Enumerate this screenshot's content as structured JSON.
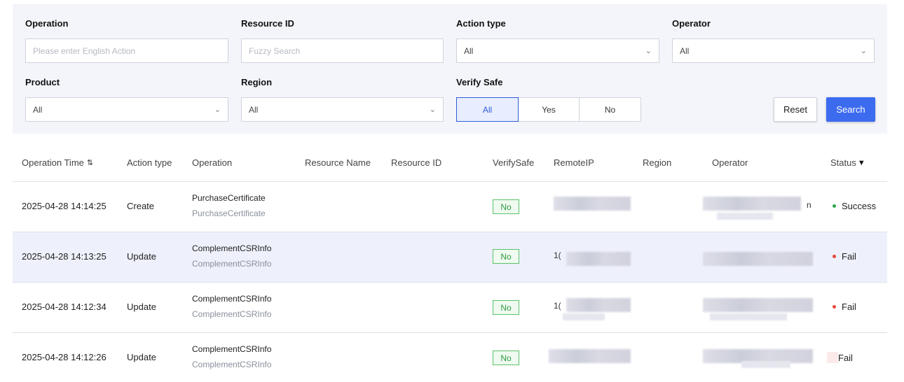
{
  "filters": {
    "operation": {
      "label": "Operation",
      "placeholder": "Please enter English Action"
    },
    "resource_id": {
      "label": "Resource ID",
      "placeholder": "Fuzzy Search"
    },
    "action_type": {
      "label": "Action type",
      "value": "All"
    },
    "operator": {
      "label": "Operator",
      "value": "All"
    },
    "product": {
      "label": "Product",
      "value": "All"
    },
    "region": {
      "label": "Region",
      "value": "All"
    },
    "verify_safe": {
      "label": "Verify Safe",
      "options": [
        "All",
        "Yes",
        "No"
      ],
      "selected": "All"
    },
    "reset_label": "Reset",
    "search_label": "Search"
  },
  "table": {
    "headers": {
      "time": "Operation Time",
      "action": "Action type",
      "operation": "Operation",
      "resource_name": "Resource Name",
      "resource_id": "Resource ID",
      "verify": "VerifySafe",
      "ip": "RemoteIP",
      "region": "Region",
      "operator": "Operator",
      "status": "Status"
    },
    "rows": [
      {
        "time": "2025-04-28 14:14:25",
        "action": "Create",
        "op_main": "PurchaseCertificate",
        "op_sub": "PurchaseCertificate",
        "verify": "No",
        "ip_frag": "",
        "op_frag": "n",
        "status": "Success"
      },
      {
        "time": "2025-04-28 14:13:25",
        "action": "Update",
        "op_main": "ComplementCSRInfo",
        "op_sub": "ComplementCSRInfo",
        "verify": "No",
        "ip_frag": "1(",
        "op_frag": "",
        "status": "Fail"
      },
      {
        "time": "2025-04-28 14:12:34",
        "action": "Update",
        "op_main": "ComplementCSRInfo",
        "op_sub": "ComplementCSRInfo",
        "verify": "No",
        "ip_frag": "1(",
        "op_frag": "",
        "status": "Fail"
      },
      {
        "time": "2025-04-28 14:12:26",
        "action": "Update",
        "op_main": "ComplementCSRInfo",
        "op_sub": "ComplementCSRInfo",
        "verify": "No",
        "ip_frag": "",
        "op_frag": "",
        "status": "Fail"
      }
    ]
  },
  "colors": {
    "success": "#2fa84f",
    "fail": "#e5483b",
    "primary": "#3d6bf0"
  },
  "icons": {
    "sort": "sort-icon",
    "filter": "filter-icon",
    "chevron": "chevron-down-icon"
  }
}
